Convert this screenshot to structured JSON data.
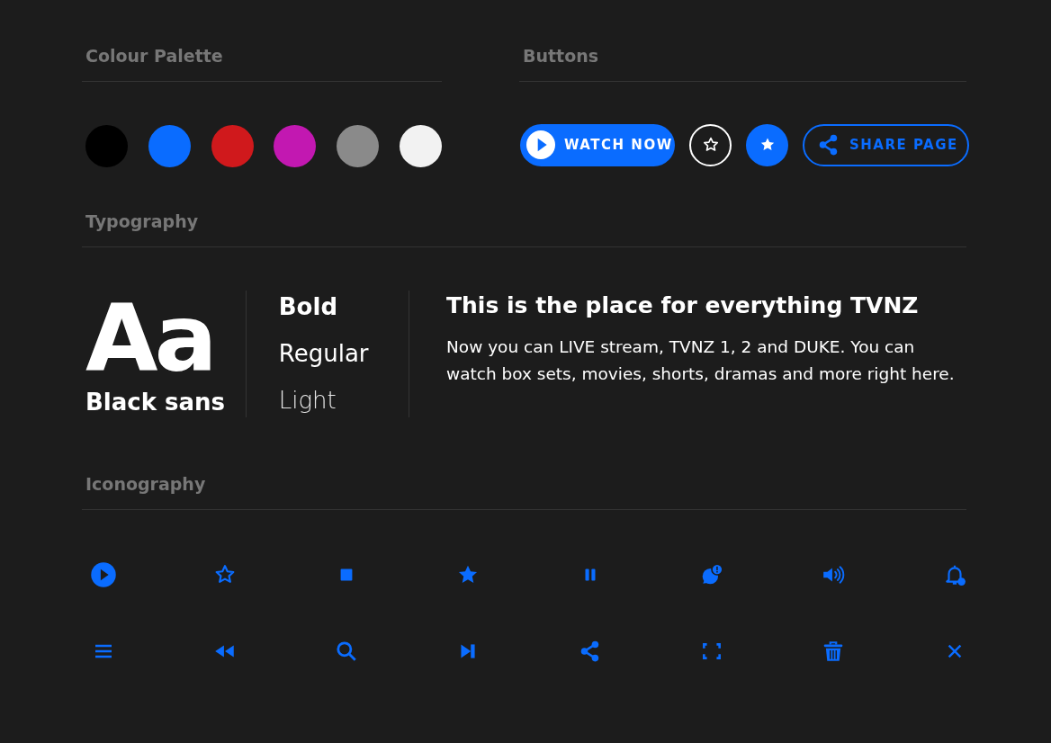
{
  "palette": {
    "title": "Colour Palette",
    "colors": [
      {
        "color": "#000000"
      },
      {
        "color": "#0a6cff"
      },
      {
        "color": "#d0191c"
      },
      {
        "color": "#c218b1"
      },
      {
        "color": "#8a8a8a"
      },
      {
        "color": "#f2f2f2"
      }
    ]
  },
  "buttons": {
    "title": "Buttons",
    "items": [
      {
        "kind": "primary",
        "label": "WATCH NOW"
      },
      {
        "kind": "icon-outline"
      },
      {
        "kind": "icon-filled"
      },
      {
        "kind": "outline",
        "label": "SHARE PAGE"
      }
    ]
  },
  "typography": {
    "title": "Typography",
    "sample": "Aa",
    "family": "Black sans",
    "weights": [
      {
        "kind": "bold",
        "label": "Bold"
      },
      {
        "kind": "regular",
        "label": "Regular"
      },
      {
        "kind": "light",
        "label": "Light"
      }
    ],
    "heading": "This is the place for everything TVNZ",
    "paragraph": "Now you can LIVE stream, TVNZ 1, 2 and DUKE. You can watch box sets, movies, shorts, dramas and more right here."
  },
  "iconography": {
    "title": "Iconography"
  }
}
